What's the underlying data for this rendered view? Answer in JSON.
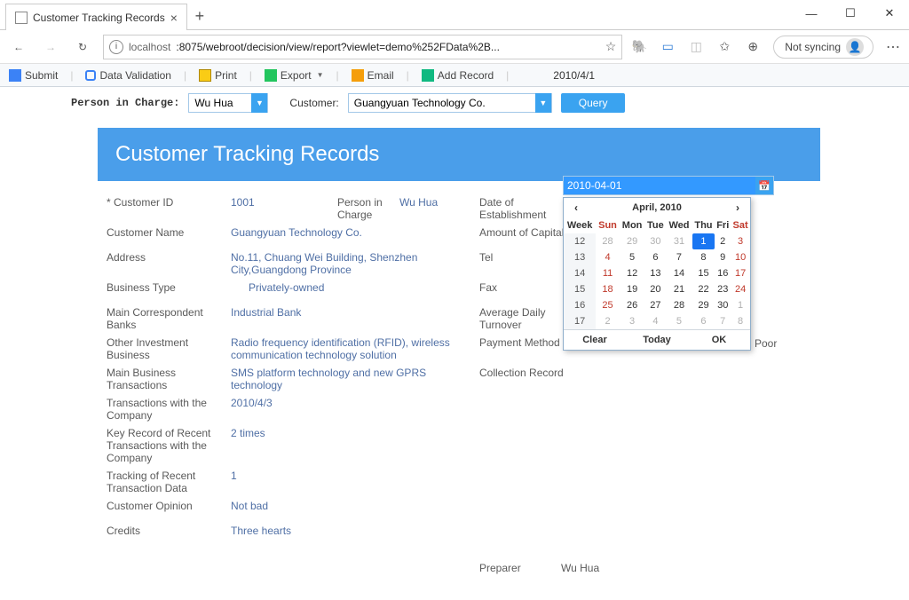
{
  "browser": {
    "tab_title": "Customer Tracking Records",
    "url_host": "localhost",
    "url_path": ":8075/webroot/decision/view/report?viewlet=demo%252FData%2B...",
    "not_syncing": "Not syncing"
  },
  "toolbar": {
    "submit": "Submit",
    "data_validation": "Data Validation",
    "print": "Print",
    "export": "Export",
    "email": "Email",
    "add_record": "Add Record",
    "date_display": "2010/4/1"
  },
  "filters": {
    "person_label": "Person in Charge:",
    "person_value": "Wu Hua",
    "customer_label": "Customer:",
    "customer_value": "Guangyuan Technology Co.",
    "query": "Query"
  },
  "banner": "Customer Tracking Records",
  "record": {
    "customer_id_label": "* Customer ID",
    "customer_id": "1001",
    "person_in_charge_label": "Person in Charge",
    "person_in_charge": "Wu Hua",
    "date_est_label": "Date of Establishment",
    "customer_name_label": "Customer Name",
    "customer_name": "Guangyuan Technology Co.",
    "amount_capital_label": "Amount of Capital",
    "address_label": "Address",
    "address": "No.11, Chuang Wei Building, Shenzhen City,Guangdong Province",
    "tel_label": "Tel",
    "business_type_label": "Business Type",
    "business_type": "Privately-owned",
    "fax_label": "Fax",
    "main_banks_label": "Main Correspondent Banks",
    "main_banks": "Industrial Bank",
    "avg_turnover_label": "Average Daily Turnover",
    "other_inv_label": "Other Investment Business",
    "other_inv": "Radio frequency identification (RFID), wireless communication technology solution",
    "payment_method_label": "Payment Method",
    "main_biz_label": "Main Business Transactions",
    "main_biz": "SMS platform technology and new GPRS technology",
    "collection_label": "Collection Record",
    "collection_value": "Poor",
    "trans_company_label": "Transactions with the Company",
    "trans_company": "2010/4/3",
    "key_record_label": "Key Record of Recent Transactions with the Company",
    "key_record": "2 times",
    "tracking_label": "Tracking of Recent Transaction Data",
    "tracking": "1",
    "opinion_label": "Customer Opinion",
    "opinion": "Not bad",
    "credits_label": "Credits",
    "credits": "Three hearts",
    "preparer_label": "Preparer",
    "preparer": "Wu Hua"
  },
  "datepicker": {
    "input_value": "2010-04-01",
    "header": "April, 2010",
    "dow": {
      "week": "Week",
      "sun": "Sun",
      "mon": "Mon",
      "tue": "Tue",
      "wed": "Wed",
      "thu": "Thu",
      "fri": "Fri",
      "sat": "Sat"
    },
    "weeks": [
      {
        "wk": "12",
        "days": [
          "28",
          "29",
          "30",
          "31",
          "1",
          "2",
          "3"
        ],
        "dim": [
          0,
          1,
          2,
          3
        ],
        "sel": 4
      },
      {
        "wk": "13",
        "days": [
          "4",
          "5",
          "6",
          "7",
          "8",
          "9",
          "10"
        ]
      },
      {
        "wk": "14",
        "days": [
          "11",
          "12",
          "13",
          "14",
          "15",
          "16",
          "17"
        ]
      },
      {
        "wk": "15",
        "days": [
          "18",
          "19",
          "20",
          "21",
          "22",
          "23",
          "24"
        ]
      },
      {
        "wk": "16",
        "days": [
          "25",
          "26",
          "27",
          "28",
          "29",
          "30",
          "1"
        ],
        "dim": [
          6
        ]
      },
      {
        "wk": "17",
        "days": [
          "2",
          "3",
          "4",
          "5",
          "6",
          "7",
          "8"
        ],
        "dim": [
          0,
          1,
          2,
          3,
          4,
          5,
          6
        ]
      }
    ],
    "clear": "Clear",
    "today": "Today",
    "ok": "OK"
  }
}
